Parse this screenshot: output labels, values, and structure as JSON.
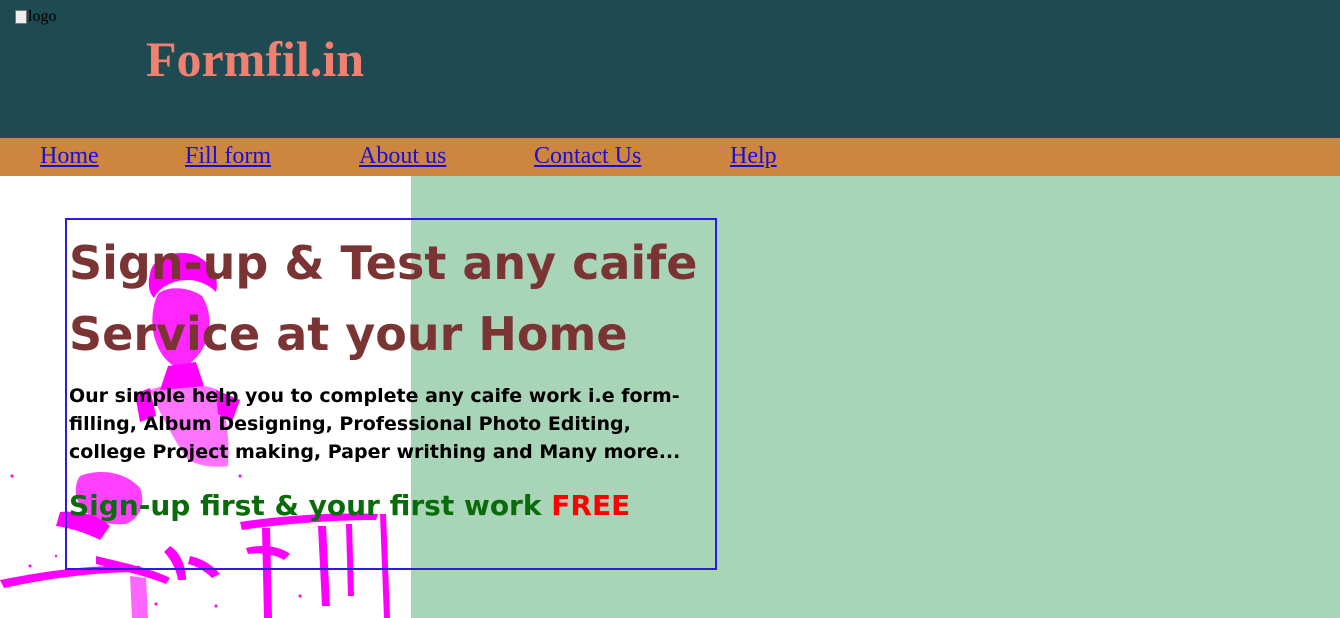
{
  "header": {
    "logo_alt": "logo",
    "site_title": "Formfil.in"
  },
  "nav": {
    "items": [
      {
        "label": "Home"
      },
      {
        "label": "Fill form"
      },
      {
        "label": "About us"
      },
      {
        "label": "Contact Us"
      },
      {
        "label": "Help"
      }
    ]
  },
  "hero": {
    "title": "Sign-up & Test any caife Service at your Home",
    "description": "Our simple help you to complete any caife work i.e form-filling, Album Designing, Professional Photo Editing, college Project making, Paper writhing and Many more...",
    "offer_text": "Sign-up first & your first work",
    "offer_highlight": "FREE"
  },
  "colors": {
    "header_bg": "#1e4a52",
    "title_color": "#f08070",
    "nav_bg": "#cd853f",
    "link_color": "#1a0ddc",
    "hero_right_bg": "#a8d5b8",
    "photo_color": "#ff00ff",
    "card_border": "#2b1de0",
    "hero_title_color": "#7a3434",
    "offer_color": "#0a6b0a",
    "free_color": "#ff0000"
  }
}
